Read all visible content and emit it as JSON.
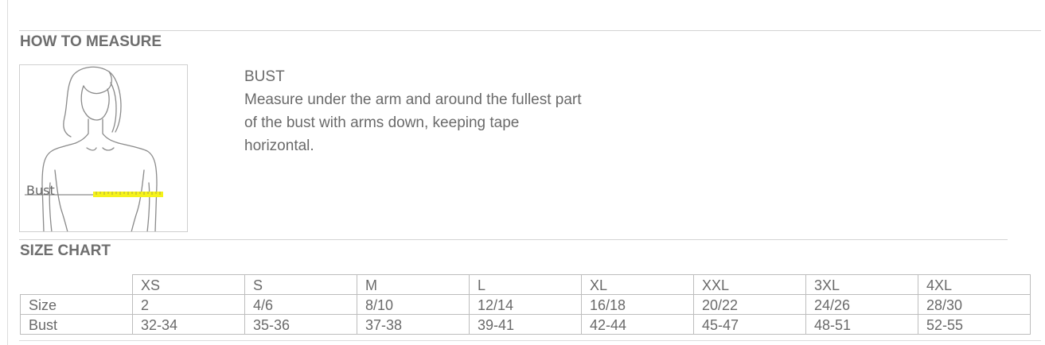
{
  "measure_section": {
    "title": "HOW TO MEASURE",
    "figure_label": "Bust",
    "item_title": "BUST",
    "item_description": "Measure under the arm and around the fullest part of the bust with arms down, keeping tape horizontal."
  },
  "size_chart": {
    "title": "SIZE CHART",
    "sizes": [
      "XS",
      "S",
      "M",
      "L",
      "XL",
      "XXL",
      "3XL",
      "4XL"
    ],
    "rows": [
      {
        "label": "Size",
        "values": [
          "2",
          "4/6",
          "8/10",
          "12/14",
          "16/18",
          "20/22",
          "24/26",
          "28/30"
        ]
      },
      {
        "label": "Bust",
        "values": [
          "32-34",
          "35-36",
          "37-38",
          "39-41",
          "42-44",
          "45-47",
          "48-51",
          "52-55"
        ]
      }
    ]
  },
  "colors": {
    "tape": "#f5f21a",
    "text": "#6a6a6a",
    "rule": "#d3d3d3"
  }
}
